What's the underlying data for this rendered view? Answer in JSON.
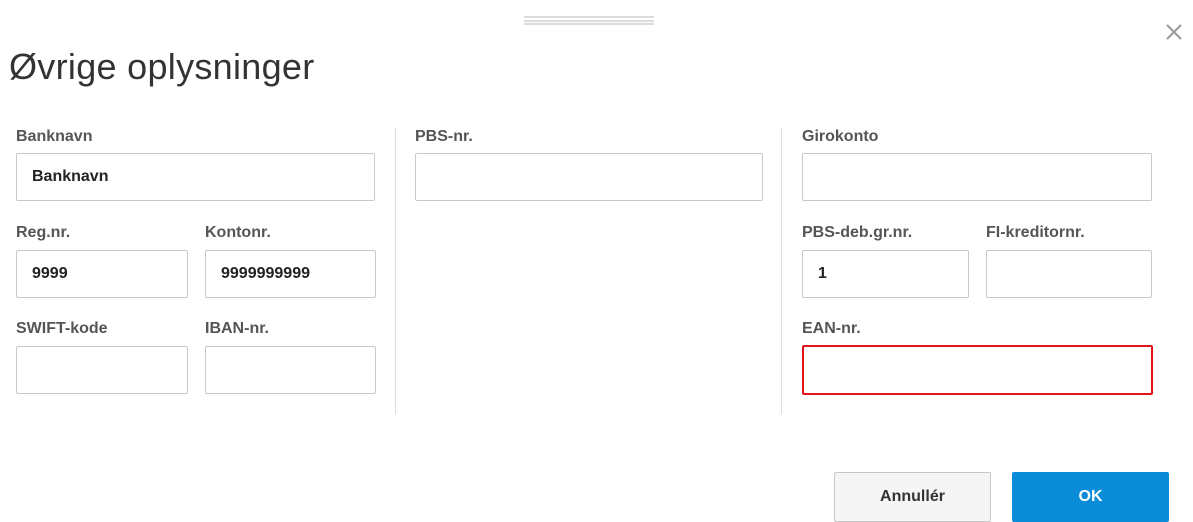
{
  "dialog": {
    "title": "Øvrige oplysninger",
    "close_icon": "close-icon"
  },
  "column1": {
    "banknavn": {
      "label": "Banknavn",
      "value": "Banknavn"
    },
    "regnr": {
      "label": "Reg.nr.",
      "value": "9999"
    },
    "kontonr": {
      "label": "Kontonr.",
      "value": "9999999999"
    },
    "swift": {
      "label": "SWIFT-kode",
      "value": ""
    },
    "iban": {
      "label": "IBAN-nr.",
      "value": ""
    }
  },
  "column2": {
    "pbsnr": {
      "label": "PBS-nr.",
      "value": ""
    }
  },
  "column3": {
    "girokonto": {
      "label": "Girokonto",
      "value": ""
    },
    "pbsdeb": {
      "label": "PBS-deb.gr.nr.",
      "value": "1"
    },
    "fikreditor": {
      "label": "FI-kreditornr.",
      "value": ""
    },
    "ean": {
      "label": "EAN-nr.",
      "value": "",
      "error_color": "#e5141a"
    }
  },
  "footer": {
    "cancel_label": "Annullér",
    "ok_label": "OK",
    "ok_color": "#0a8cd9"
  }
}
